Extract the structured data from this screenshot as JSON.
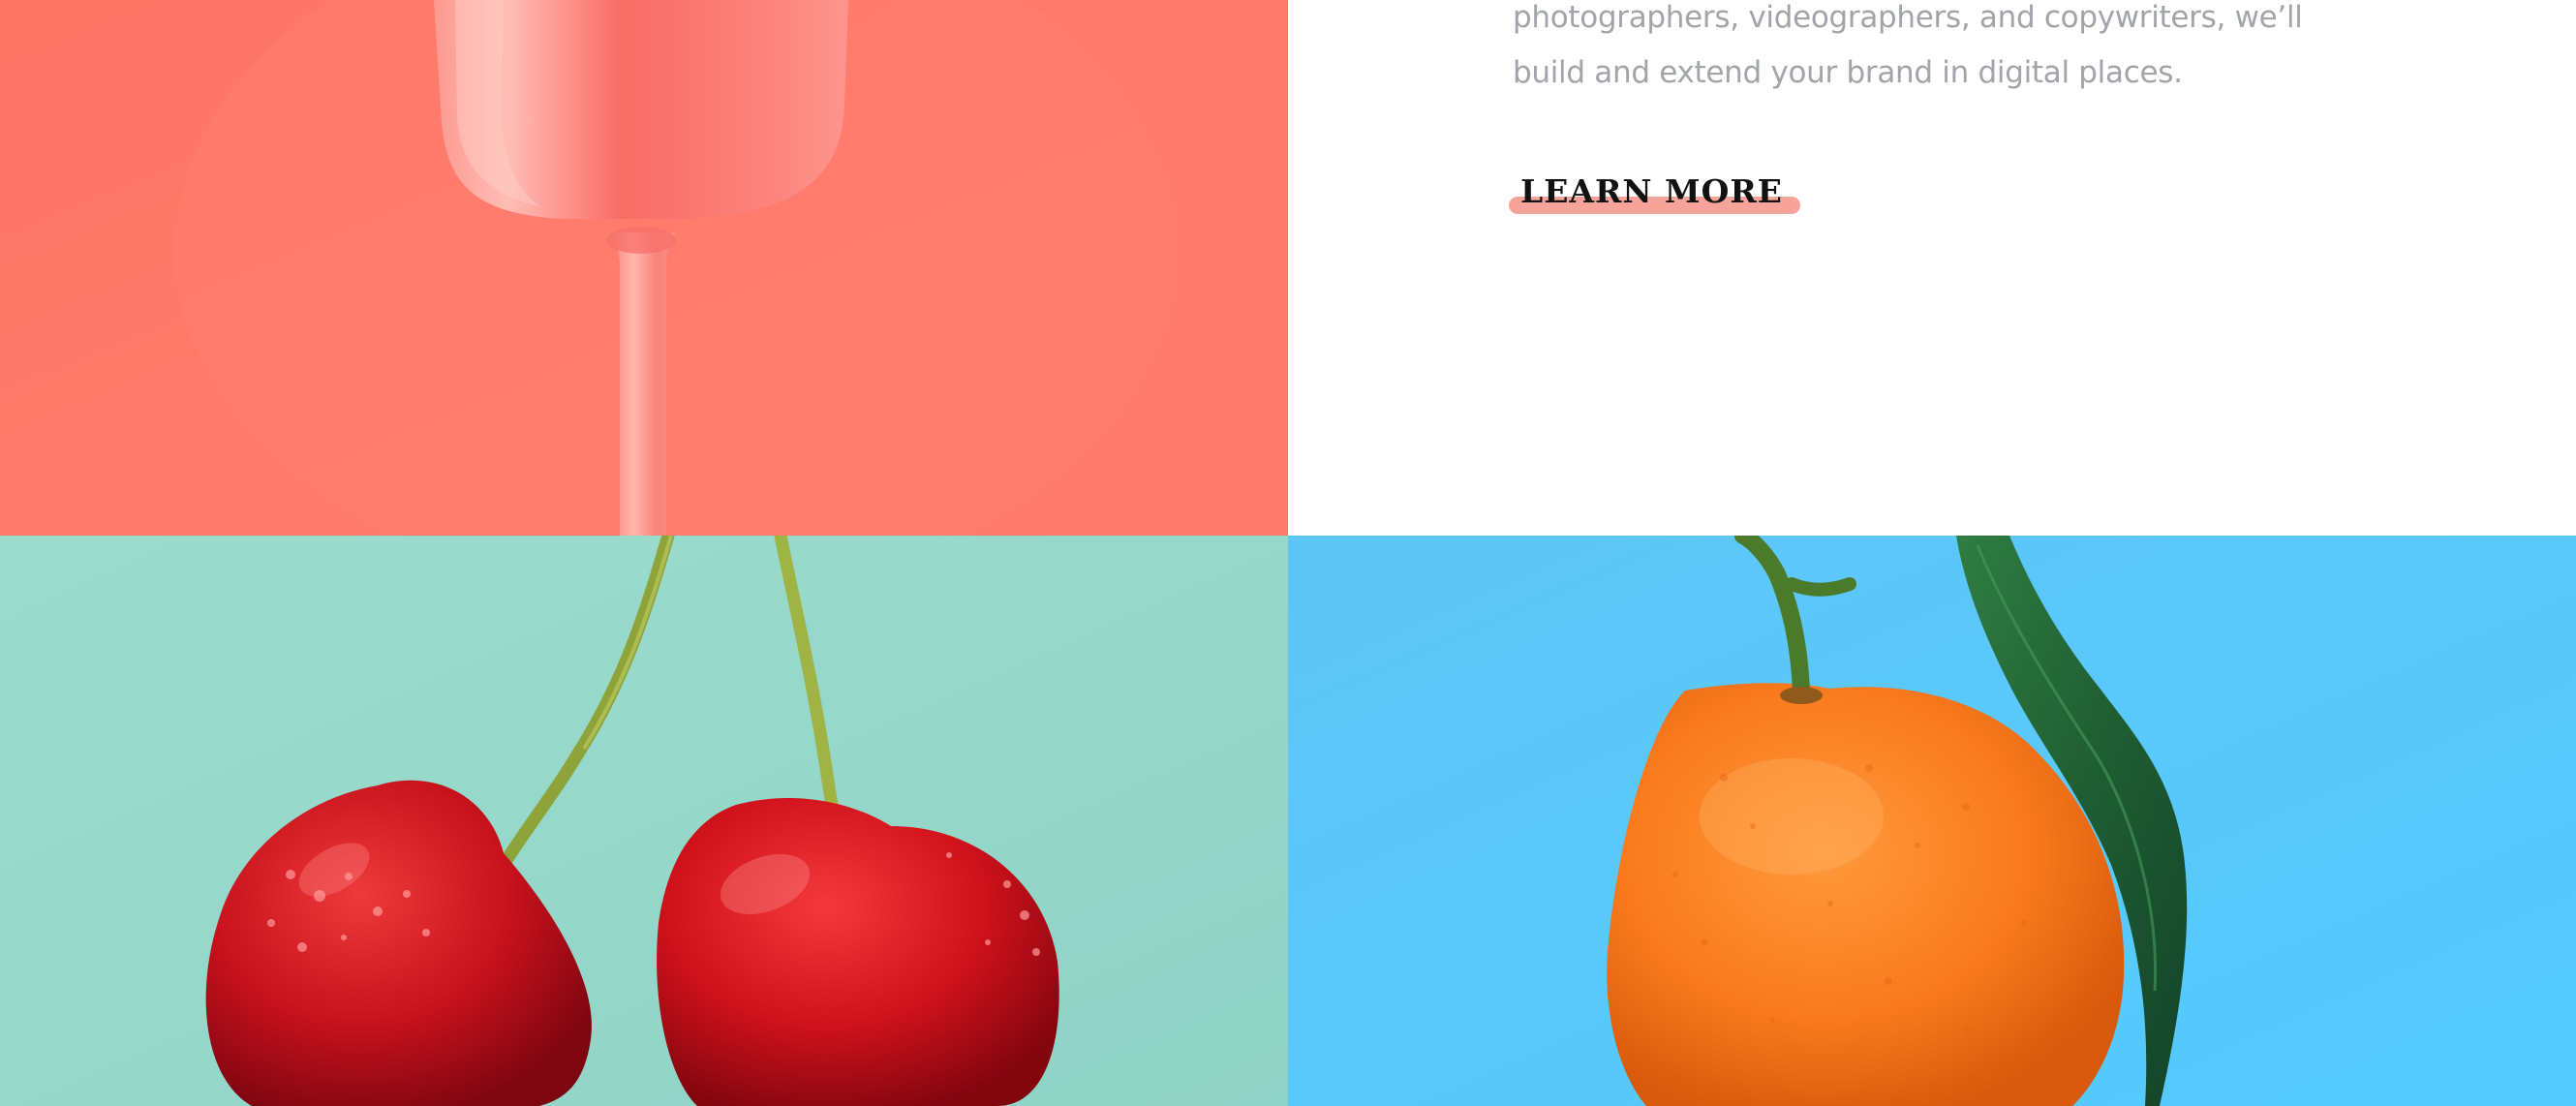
{
  "body_text": {
    "line_1": "photographers, videographers, and copywriters, we’ll",
    "line_2": "build and extend your brand in digital places."
  },
  "cta": {
    "label": "LEARN MORE",
    "underline_color": "#f7a39a"
  },
  "images": {
    "glass": {
      "subject": "pink wine glass on coral background",
      "background": "#fe7768"
    },
    "cherries": {
      "subject": "two red cherries on mint background",
      "background": "#9cdbcd"
    },
    "orange": {
      "subject": "tangerine with leaf on sky-blue background",
      "background": "#5bc8fb"
    }
  }
}
